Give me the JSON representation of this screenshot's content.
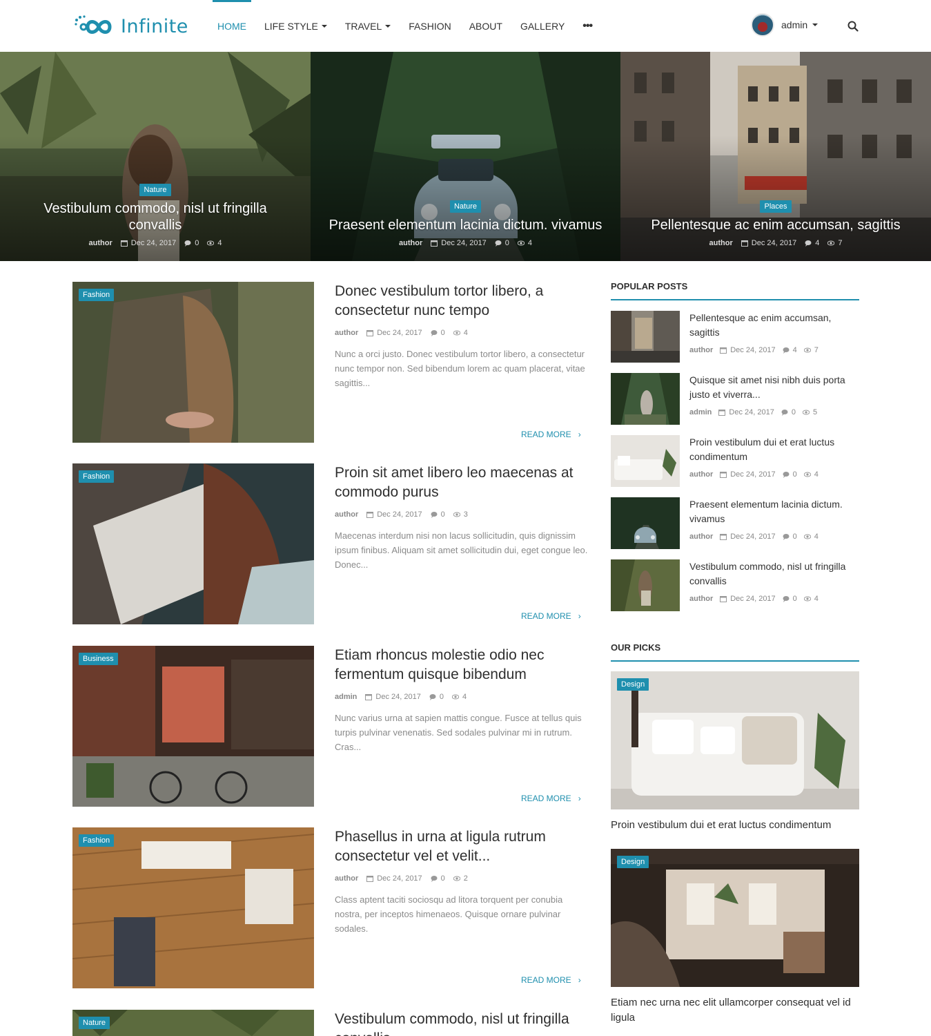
{
  "header": {
    "logo_text": "Infinite",
    "nav": [
      {
        "label": "HOME",
        "dropdown": false
      },
      {
        "label": "LIFE STYLE",
        "dropdown": true
      },
      {
        "label": "TRAVEL",
        "dropdown": true
      },
      {
        "label": "FASHION",
        "dropdown": false
      },
      {
        "label": "ABOUT",
        "dropdown": false
      },
      {
        "label": "GALLERY",
        "dropdown": false
      }
    ],
    "more_label": "•••",
    "user_name": "admin",
    "accent": "#1f8fae"
  },
  "hero": [
    {
      "category": "Nature",
      "title": "Vestibulum commodo, nisl ut fringilla convallis",
      "author": "author",
      "date": "Dec 24, 2017",
      "comments": "0",
      "views": "4"
    },
    {
      "category": "Nature",
      "title": "Praesent elementum lacinia dictum. vivamus",
      "author": "author",
      "date": "Dec 24, 2017",
      "comments": "0",
      "views": "4"
    },
    {
      "category": "Places",
      "title": "Pellentesque ac enim accumsan, sagittis",
      "author": "author",
      "date": "Dec 24, 2017",
      "comments": "4",
      "views": "7"
    }
  ],
  "posts": [
    {
      "category": "Fashion",
      "title": "Donec vestibulum tortor libero, a consectetur nunc tempo",
      "author": "author",
      "date": "Dec 24, 2017",
      "comments": "0",
      "views": "4",
      "excerpt": "Nunc a orci justo. Donec vestibulum tortor libero, a consectetur nunc tempor non. Sed bibendum lorem ac quam placerat, vitae sagittis...",
      "read_more": "READ MORE"
    },
    {
      "category": "Fashion",
      "title": "Proin sit amet libero leo maecenas at commodo purus",
      "author": "author",
      "date": "Dec 24, 2017",
      "comments": "0",
      "views": "3",
      "excerpt": "Maecenas interdum nisi non lacus sollicitudin, quis dignissim ipsum finibus. Aliquam sit amet sollicitudin dui, eget congue leo. Donec...",
      "read_more": "READ MORE"
    },
    {
      "category": "Business",
      "title": "Etiam rhoncus molestie odio nec fermentum quisque bibendum",
      "author": "admin",
      "date": "Dec 24, 2017",
      "comments": "0",
      "views": "4",
      "excerpt": "Nunc varius urna at sapien mattis congue. Fusce at tellus quis turpis pulvinar venenatis. Sed sodales pulvinar mi in rutrum. Cras...",
      "read_more": "READ MORE"
    },
    {
      "category": "Fashion",
      "title": "Phasellus in urna at ligula rutrum consectetur vel et velit...",
      "author": "author",
      "date": "Dec 24, 2017",
      "comments": "0",
      "views": "2",
      "excerpt": "Class aptent taciti sociosqu ad litora torquent per conubia nostra, per inceptos himenaeos. Quisque ornare pulvinar sodales.",
      "read_more": "READ MORE"
    },
    {
      "category": "Nature",
      "title": "Vestibulum commodo, nisl ut fringilla convallis",
      "author": "",
      "date": "",
      "comments": "",
      "views": "",
      "excerpt": "",
      "read_more": ""
    }
  ],
  "sidebar": {
    "popular_heading": "POPULAR POSTS",
    "popular": [
      {
        "title": "Pellentesque ac enim accumsan, sagittis",
        "author": "author",
        "date": "Dec 24, 2017",
        "comments": "4",
        "views": "7"
      },
      {
        "title": "Quisque sit amet nisi nibh duis porta justo et viverra...",
        "author": "admin",
        "date": "Dec 24, 2017",
        "comments": "0",
        "views": "5"
      },
      {
        "title": "Proin vestibulum dui et erat luctus condimentum",
        "author": "author",
        "date": "Dec 24, 2017",
        "comments": "0",
        "views": "4"
      },
      {
        "title": "Praesent elementum lacinia dictum. vivamus",
        "author": "author",
        "date": "Dec 24, 2017",
        "comments": "0",
        "views": "4"
      },
      {
        "title": "Vestibulum commodo, nisl ut fringilla convallis",
        "author": "author",
        "date": "Dec 24, 2017",
        "comments": "0",
        "views": "4"
      }
    ],
    "picks_heading": "OUR PICKS",
    "picks": [
      {
        "category": "Design",
        "title": "Proin vestibulum dui et erat luctus condimentum"
      },
      {
        "category": "Design",
        "title": "Etiam nec urna nec elit ullamcorper consequat vel id ligula"
      }
    ]
  }
}
